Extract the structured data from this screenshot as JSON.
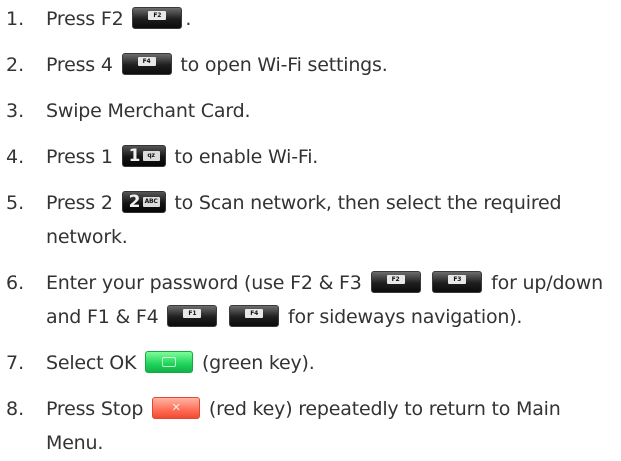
{
  "steps": [
    {
      "num": "1.",
      "parts": [
        "Press F2 ",
        "."
      ],
      "keys": [
        {
          "type": "fkey",
          "label": "F2",
          "name": "f2-key-icon"
        }
      ]
    },
    {
      "num": "2.",
      "parts": [
        "Press 4 ",
        " to open Wi-Fi settings."
      ],
      "keys": [
        {
          "type": "fkey",
          "label": "F4",
          "name": "f4-key-icon"
        }
      ]
    },
    {
      "num": "3.",
      "parts": [
        "Swipe Merchant Card."
      ],
      "keys": []
    },
    {
      "num": "4.",
      "parts": [
        "Press 1 ",
        " to enable Wi-Fi."
      ],
      "keys": [
        {
          "type": "numkey",
          "digit": "1",
          "letters": "qz",
          "name": "one-key-icon"
        }
      ]
    },
    {
      "num": "5.",
      "parts": [
        "Press 2 ",
        " to Scan network, then select the required network."
      ],
      "keys": [
        {
          "type": "numkey",
          "digit": "2",
          "letters": "ABC",
          "name": "two-key-icon"
        }
      ]
    },
    {
      "num": "6.",
      "parts": [
        "Enter your password (use F2 & F3 ",
        " ",
        " for up/down and F1 & F4 ",
        " ",
        " for sideways navigation)."
      ],
      "keys": [
        {
          "type": "fkey",
          "label": "F2",
          "name": "f2-key-icon"
        },
        {
          "type": "fkey",
          "label": "F3",
          "name": "f3-key-icon"
        },
        {
          "type": "fkey",
          "label": "F1",
          "name": "f1-key-icon"
        },
        {
          "type": "fkey",
          "label": "F4",
          "name": "f4-key-icon"
        }
      ]
    },
    {
      "num": "7.",
      "parts": [
        "Select OK ",
        " (green key)."
      ],
      "keys": [
        {
          "type": "green",
          "name": "ok-green-key-icon"
        }
      ]
    },
    {
      "num": "8.",
      "parts": [
        "Press Stop ",
        " (red key) repeatedly to return to Main Menu."
      ],
      "keys": [
        {
          "type": "red",
          "name": "stop-red-key-icon"
        }
      ]
    }
  ],
  "colors": {
    "text": "#333333",
    "green_key": "#1fd35a",
    "red_key": "#ff6e55"
  }
}
